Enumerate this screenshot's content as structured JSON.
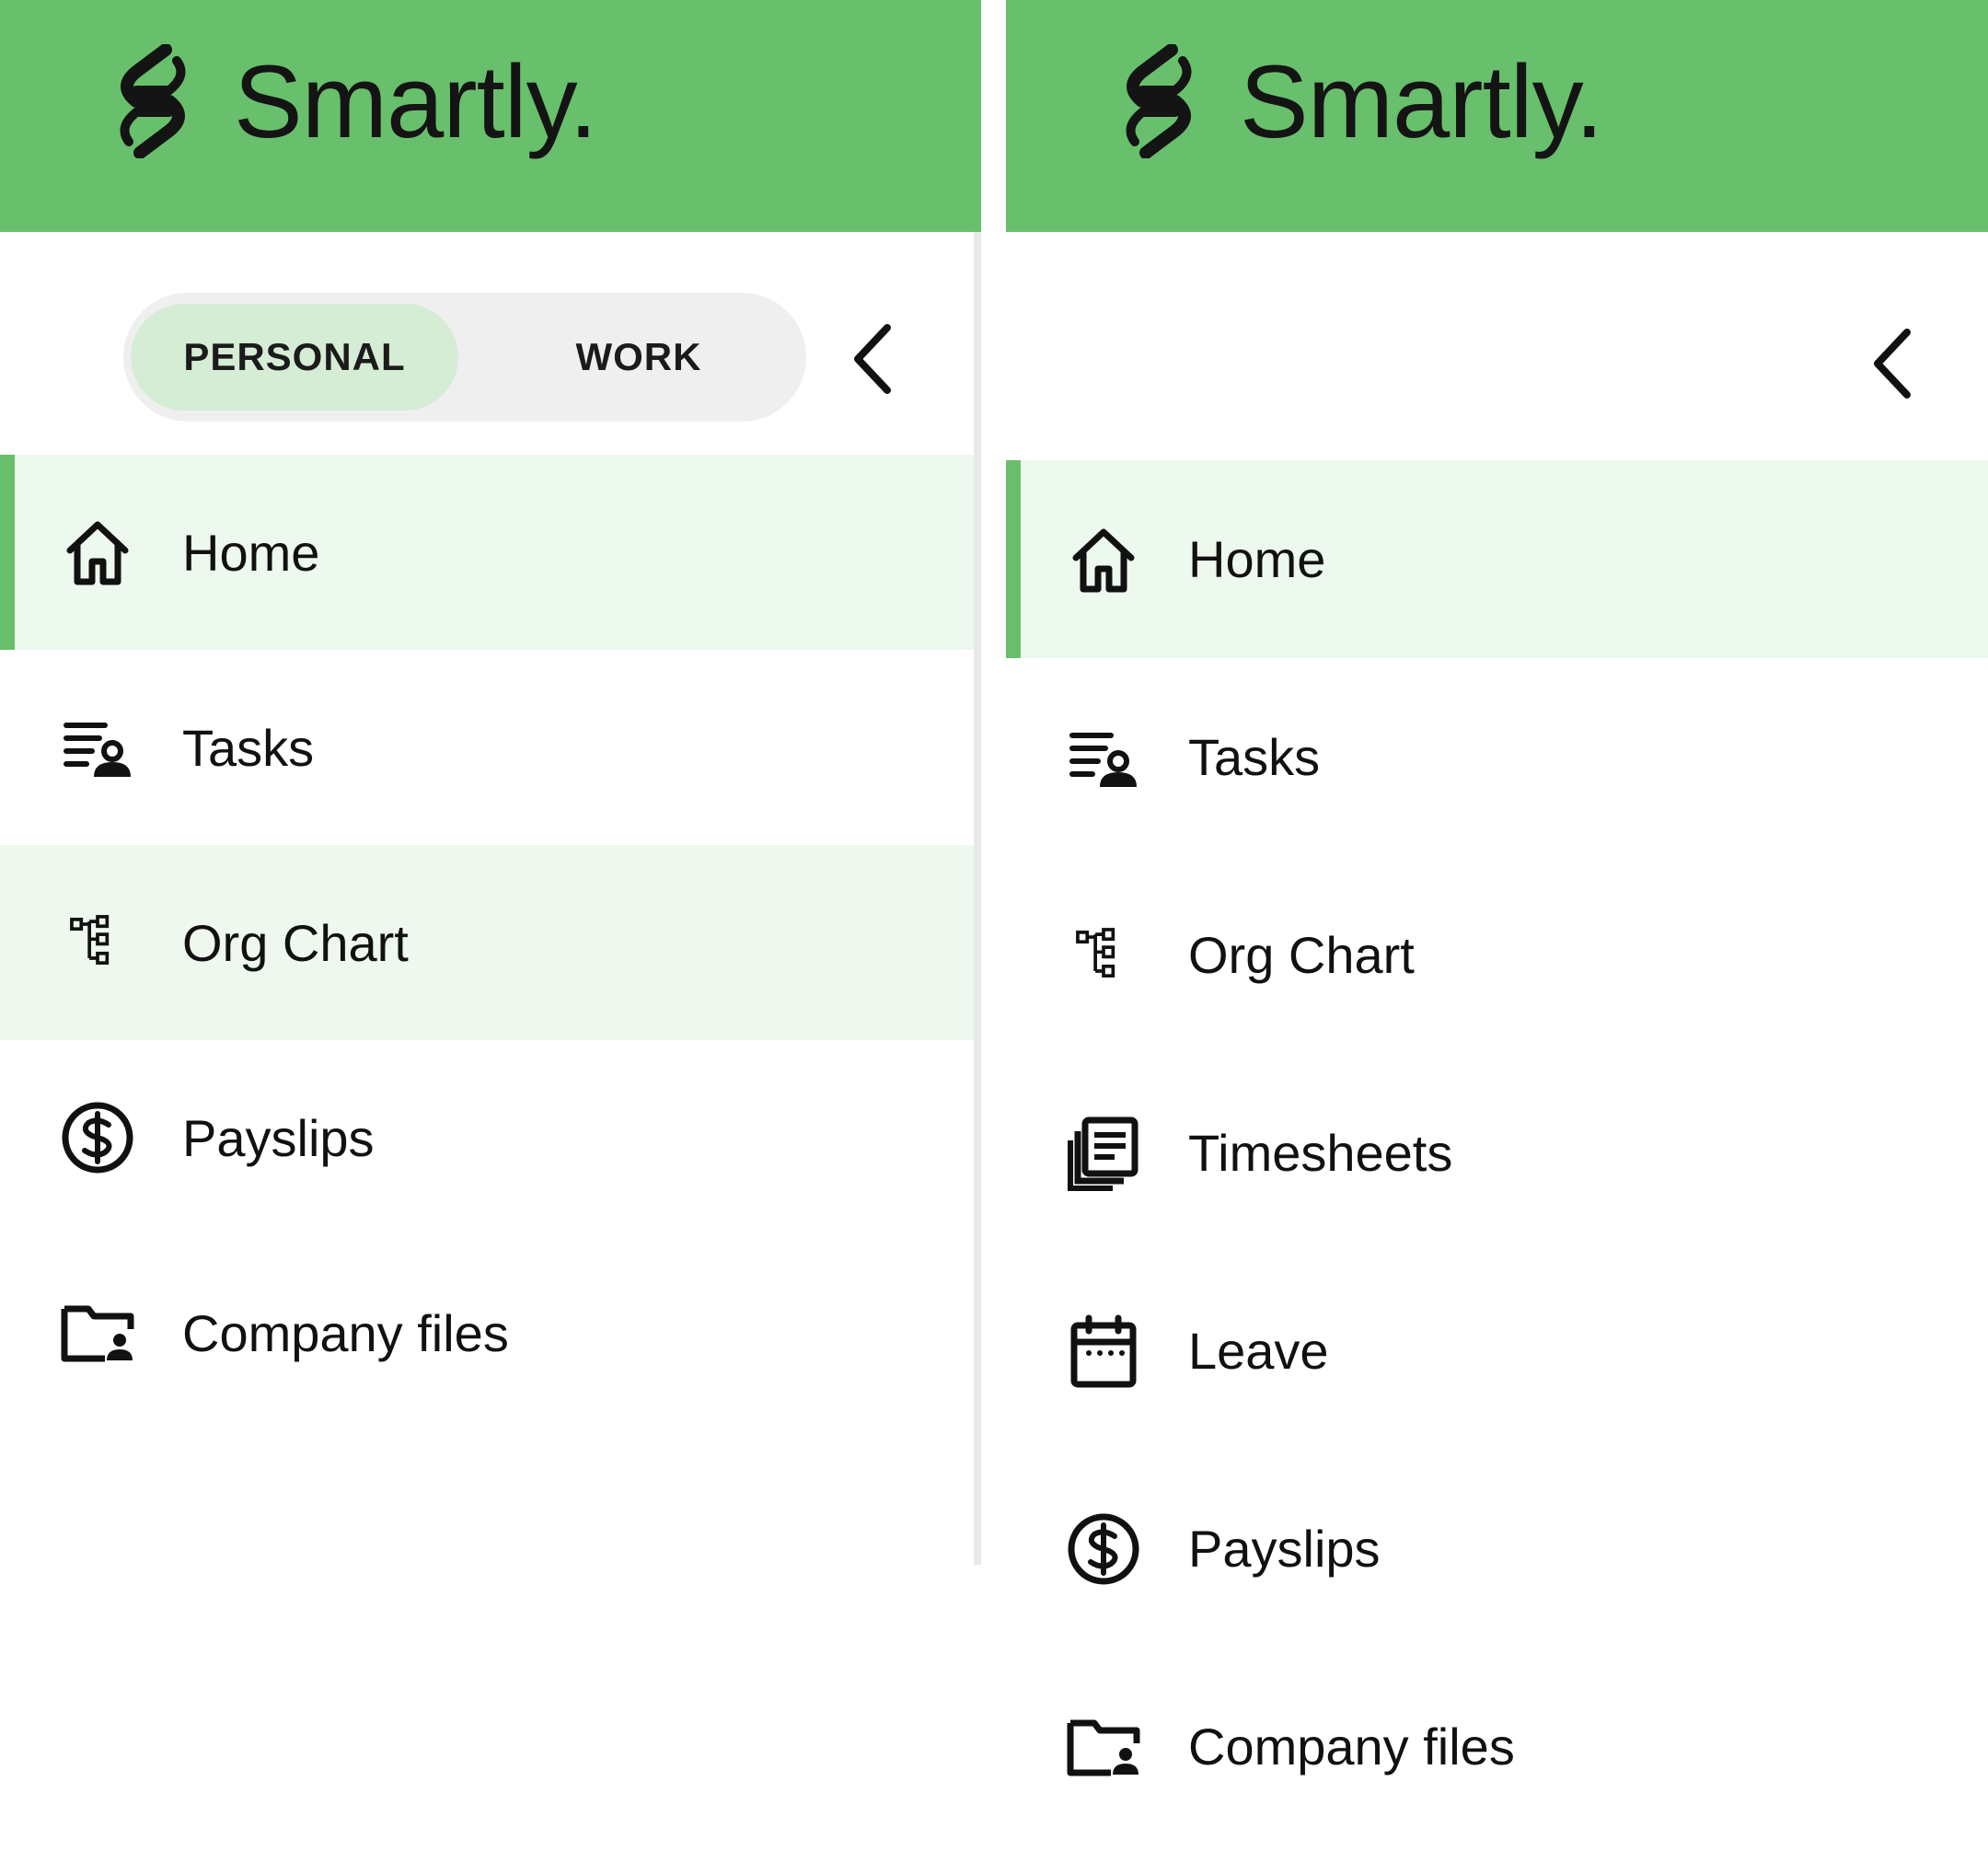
{
  "brand": {
    "name": "Smartly.",
    "color": "#68c06c"
  },
  "left_panel": {
    "toggle": {
      "active": "PERSONAL",
      "inactive": "WORK"
    },
    "nav": [
      {
        "label": "Home",
        "icon": "home-icon",
        "state": "selected"
      },
      {
        "label": "Tasks",
        "icon": "tasks-icon",
        "state": "normal"
      },
      {
        "label": "Org Chart",
        "icon": "org-chart-icon",
        "state": "hover"
      },
      {
        "label": "Payslips",
        "icon": "dollar-circle-icon",
        "state": "normal"
      },
      {
        "label": "Company files",
        "icon": "folder-user-icon",
        "state": "normal"
      }
    ]
  },
  "right_panel": {
    "nav": [
      {
        "label": "Home",
        "icon": "home-icon",
        "state": "selected"
      },
      {
        "label": "Tasks",
        "icon": "tasks-icon",
        "state": "normal"
      },
      {
        "label": "Org Chart",
        "icon": "org-chart-icon",
        "state": "normal"
      },
      {
        "label": "Timesheets",
        "icon": "timesheets-icon",
        "state": "normal"
      },
      {
        "label": "Leave",
        "icon": "calendar-icon",
        "state": "normal"
      },
      {
        "label": "Payslips",
        "icon": "dollar-circle-icon",
        "state": "normal"
      },
      {
        "label": "Company files",
        "icon": "folder-user-icon",
        "state": "normal"
      }
    ]
  }
}
